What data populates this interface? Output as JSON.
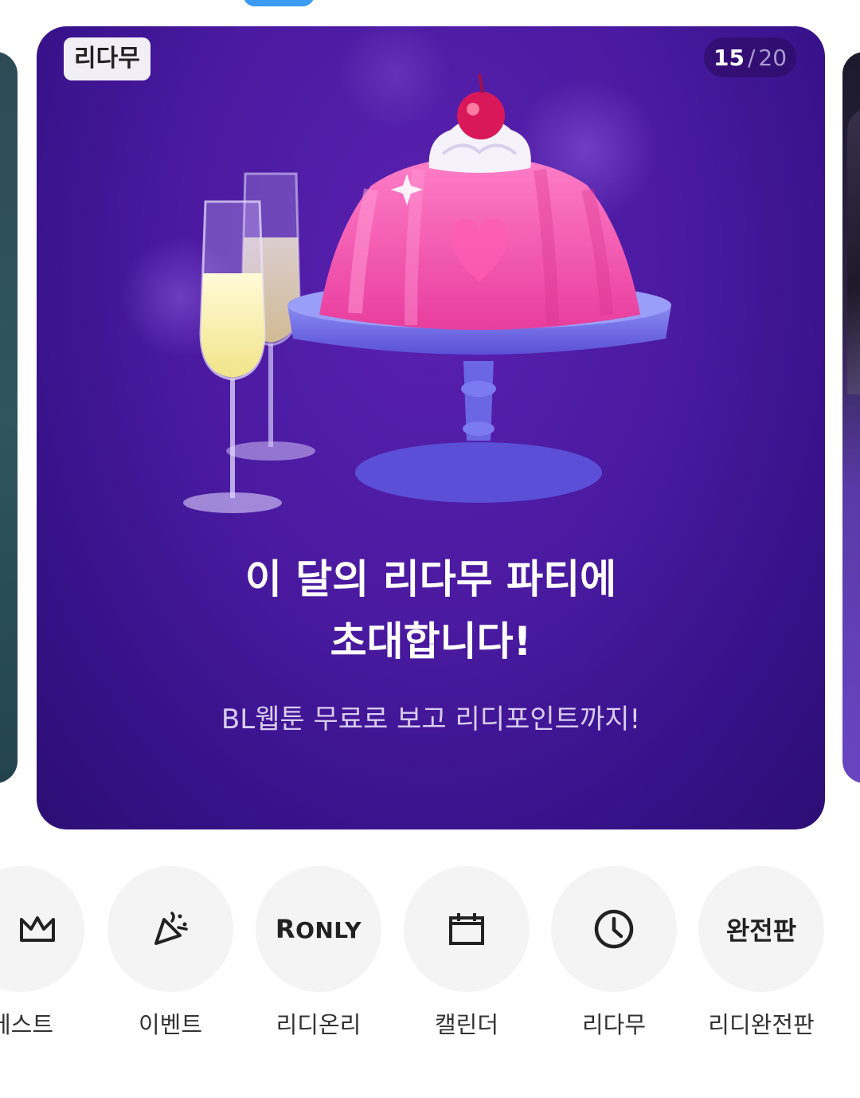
{
  "banner": {
    "badge": "리다무",
    "counter_current": "15",
    "counter_separator": "/",
    "counter_total": "20",
    "headline_line1": "이 달의 리다무 파티에",
    "headline_line2": "초대합니다!",
    "subline": "BL웹툰 무료로 보고 리디포인트까지!",
    "background_color": "#4a1aa0"
  },
  "shortcuts": [
    {
      "label": "베스트",
      "icon": "crown-icon"
    },
    {
      "label": "이벤트",
      "icon": "party-popper-icon"
    },
    {
      "label": "리디온리",
      "icon": "r-only-logo",
      "icon_text_r": "R",
      "icon_text_only": "ONLY"
    },
    {
      "label": "캘린더",
      "icon": "calendar-icon"
    },
    {
      "label": "리다무",
      "icon": "clock-icon"
    },
    {
      "label": "리디완전판",
      "icon": "wanjeonpan-text-icon",
      "icon_text": "완전판"
    }
  ]
}
